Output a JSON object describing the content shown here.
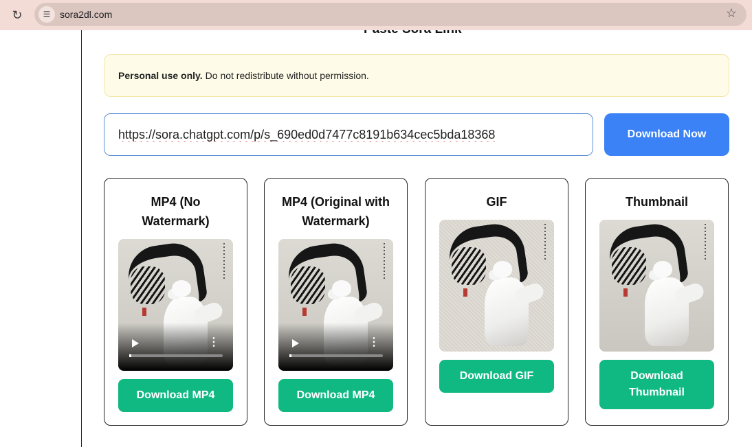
{
  "browser": {
    "url": "sora2dl.com"
  },
  "page": {
    "section_title_partial": "Paste Sora Link",
    "notice_bold": "Personal use only.",
    "notice_text": "Do not redistribute without permission.",
    "url_value": "https://sora.chatgpt.com/p/s_690ed0d7477c8191b634cec5bda18368",
    "download_now_label": "Download Now"
  },
  "cards": [
    {
      "title": "MP4 (No Watermark)",
      "button": "Download MP4"
    },
    {
      "title": "MP4 (Original with Watermark)",
      "button": "Download MP4"
    },
    {
      "title": "GIF",
      "button": "Download GIF"
    },
    {
      "title": "Thumbnail",
      "button": "Download Thumbnail"
    }
  ],
  "colors": {
    "primary": "#3b82f6",
    "success": "#10b981",
    "notice_bg": "#fefce8"
  },
  "icons": [
    "reload-icon",
    "site-controls-icon",
    "bookmark-star-icon",
    "play-icon",
    "more-vertical-icon"
  ]
}
